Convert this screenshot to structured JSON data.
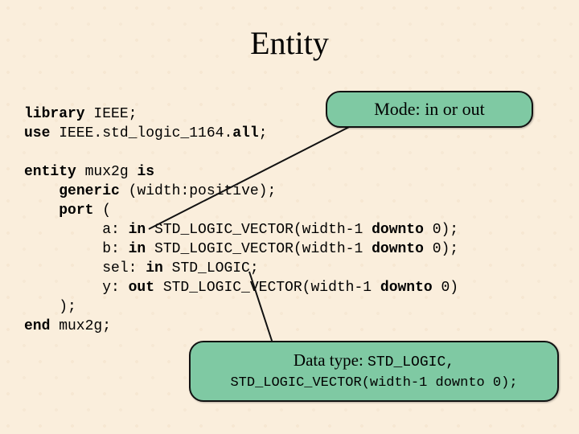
{
  "title": "Entity",
  "callouts": {
    "mode": {
      "label_prefix": "Mode: ",
      "label_text": "in or out"
    },
    "datatype": {
      "label_prefix": "Data type: ",
      "type1": "STD_LOGIC",
      "sep": ", ",
      "type2": "STD_LOGIC_VECTOR(width-1 downto 0);"
    }
  },
  "code": {
    "kw_library": "library",
    "lib_name": " IEEE;",
    "kw_use": "use",
    "use_rest": " IEEE.std_logic_1164.",
    "kw_all": "all",
    "semi": ";",
    "kw_entity": "entity",
    "entity_name": " mux2g ",
    "kw_is": "is",
    "kw_generic": "generic",
    "generic_rest": " (width:positive);",
    "kw_port": "port",
    "port_open": " (",
    "port_a_name": "a: ",
    "kw_in_a": "in",
    "port_a_rest": " STD_LOGIC_VECTOR(width-1 ",
    "kw_downto_a": "downto",
    "port_a_tail": " 0);",
    "port_b_name": "b: ",
    "kw_in_b": "in",
    "port_b_rest": " STD_LOGIC_VECTOR(width-1 ",
    "kw_downto_b": "downto",
    "port_b_tail": " 0);",
    "port_sel_name": "sel: ",
    "kw_in_sel": "in",
    "port_sel_rest": " STD_LOGIC;",
    "port_y_name": "y: ",
    "kw_out_y": "out",
    "port_y_rest": " STD_LOGIC_VECTOR(width-1 ",
    "kw_downto_y": "downto",
    "port_y_tail": " 0)",
    "port_close": ");",
    "kw_end": "end",
    "end_rest": " mux2g;"
  }
}
